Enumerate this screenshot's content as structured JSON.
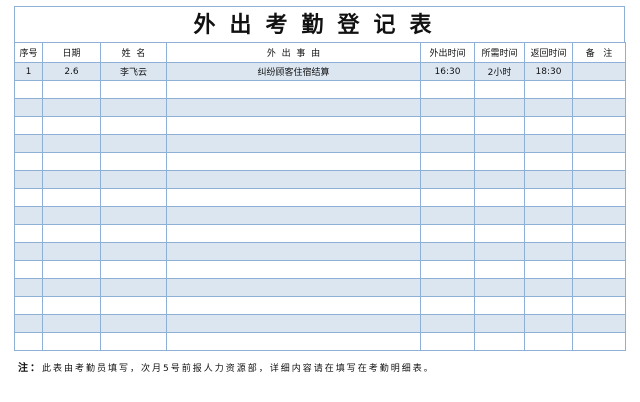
{
  "title": "外出考勤登记表",
  "headers": {
    "index": "序号",
    "date": "日期",
    "name": "姓  名",
    "reason": "外  出  事  由",
    "out_time": "外出时间",
    "duration": "所需时间",
    "return_time": "返回时间",
    "remark": "备   注"
  },
  "rows": [
    {
      "index": "1",
      "date": "2.6",
      "name": "李飞云",
      "reason": "纠纷顾客住宿结算",
      "out_time": "16:30",
      "duration": "2小时",
      "return_time": "18:30",
      "remark": ""
    }
  ],
  "empty_row_count": 15,
  "note": {
    "label": "注：",
    "text": "此表由考勤员填写，次月5号前报人力资源部，详细内容请在填写在考勤明细表。"
  },
  "colors": {
    "border": "#8fb0d6",
    "band": "#dce6f1"
  }
}
